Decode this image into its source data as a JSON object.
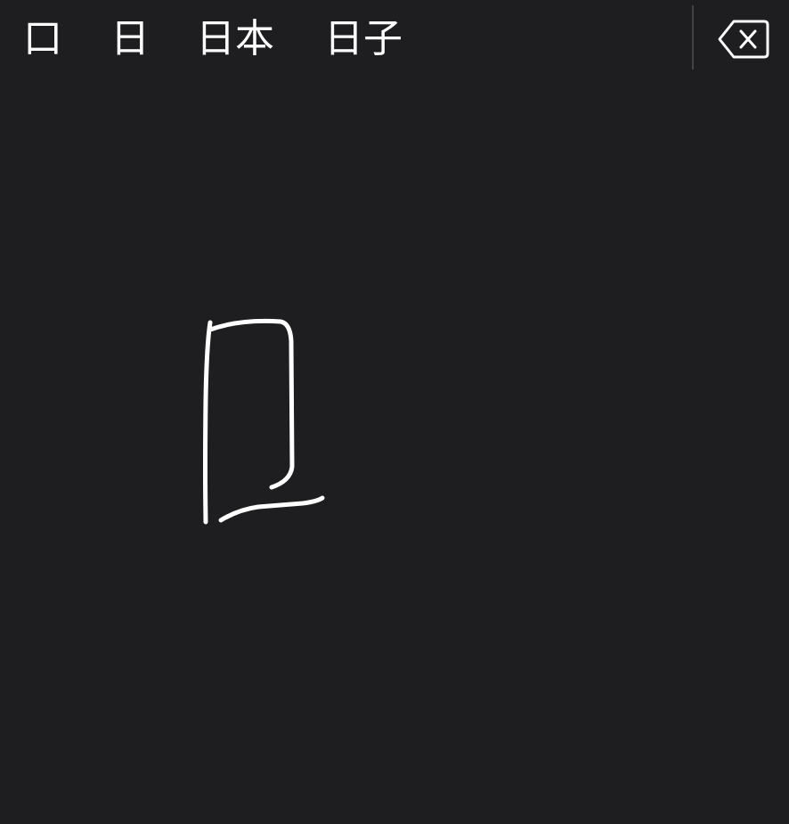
{
  "candidates": [
    "口",
    "日",
    "日本",
    "日子"
  ],
  "delete_key": {
    "icon": "delete-backspace-icon"
  },
  "colors": {
    "background": "#1e1e20",
    "text": "#ffffff",
    "ink": "#ffffff",
    "divider": "#444446"
  }
}
